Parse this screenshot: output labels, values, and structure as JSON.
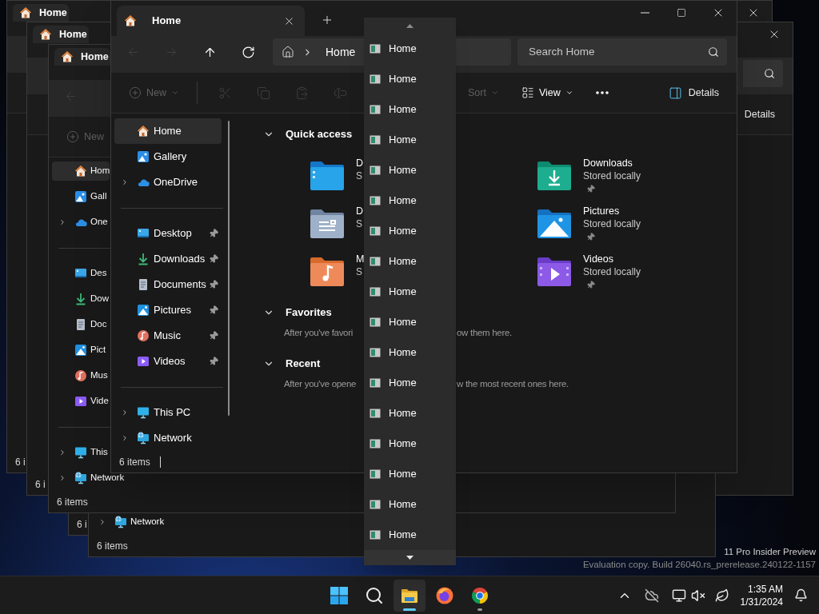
{
  "desktop": {
    "watermark": [
      "11 Pro Insider Preview",
      "Evaluation copy. Build 26040.rs_prerelease.240122-1157"
    ]
  },
  "windows": [
    {
      "tab": {
        "title": "Home",
        "selected": true
      },
      "window_buttons": [
        {
          "kind": "close"
        }
      ],
      "status": "6 i"
    },
    {
      "tab": {
        "title": "Home",
        "selected": true
      },
      "window_buttons": [
        {
          "kind": "close"
        }
      ],
      "search_icon": true,
      "details": {
        "label": "Details"
      },
      "status": "6 i"
    },
    {
      "status": "6 i"
    },
    {
      "nav": {
        "groups": [
          [
            {
              "kind": "network",
              "label": "Network",
              "expandable": true,
              "selected": false
            }
          ]
        ]
      },
      "status": "6 items"
    },
    {
      "tab": {
        "title": "Home",
        "selected": true
      },
      "nav_buttons": [
        {
          "kind": "back",
          "disabled": true
        }
      ],
      "commands": [
        {
          "kind": "new",
          "label": "New",
          "disabled": true
        }
      ],
      "nav": {
        "groups": [
          [
            {
              "kind": "home",
              "label": "Hom",
              "selected": true
            },
            {
              "kind": "gallery",
              "label": "Gall",
              "selected": false
            },
            {
              "kind": "onedrive",
              "label": "One",
              "expandable": true,
              "selected": false
            }
          ],
          [
            {
              "kind": "desktop",
              "label": "Des",
              "selected": false
            },
            {
              "kind": "downloads",
              "label": "Dow",
              "selected": false
            },
            {
              "kind": "documents",
              "label": "Doc",
              "selected": false
            },
            {
              "kind": "pictures",
              "label": "Pict",
              "selected": false
            },
            {
              "kind": "music",
              "label": "Mus",
              "selected": false
            },
            {
              "kind": "videos",
              "label": "Vide",
              "selected": false
            }
          ],
          [
            {
              "kind": "thispc",
              "label": "This",
              "expandable": true,
              "selected": false
            },
            {
              "kind": "network",
              "label": "Network",
              "expandable": true,
              "selected": false
            }
          ]
        ]
      },
      "status": "6 items"
    },
    {
      "tab": {
        "title": "Home",
        "selected": true,
        "closable": true
      },
      "new_tab_button": true,
      "window_buttons": [
        {
          "kind": "minimize"
        },
        {
          "kind": "maximize"
        },
        {
          "kind": "close"
        }
      ],
      "nav_buttons": [
        {
          "kind": "back",
          "disabled": true
        },
        {
          "kind": "forward",
          "disabled": true
        },
        {
          "kind": "up",
          "disabled": false
        },
        {
          "kind": "refresh",
          "disabled": false
        }
      ],
      "address": {
        "crumbs": [
          "Home"
        ]
      },
      "search": {
        "placeholder": "Search Home"
      },
      "commands": [
        {
          "kind": "new",
          "label": "New",
          "disabled": true
        },
        {
          "kind": "cut",
          "disabled": true
        },
        {
          "kind": "copy",
          "disabled": true
        },
        {
          "kind": "paste",
          "disabled": true
        },
        {
          "kind": "rename",
          "disabled": true
        },
        {
          "kind": "sort",
          "label": "Sort",
          "disabled": true
        },
        {
          "kind": "view",
          "label": "View",
          "disabled": false
        },
        {
          "kind": "more",
          "disabled": false
        }
      ],
      "details": {
        "label": "Details"
      },
      "nav": {
        "scrollbar": true,
        "groups": [
          [
            {
              "kind": "home",
              "label": "Home",
              "selected": true
            },
            {
              "kind": "gallery",
              "label": "Gallery",
              "selected": false
            },
            {
              "kind": "onedrive",
              "label": "OneDrive",
              "expandable": true,
              "selected": false
            }
          ],
          [
            {
              "kind": "desktop",
              "label": "Desktop",
              "pinned": true,
              "selected": false
            },
            {
              "kind": "downloads",
              "label": "Downloads",
              "pinned": true,
              "selected": false
            },
            {
              "kind": "documents",
              "label": "Documents",
              "pinned": true,
              "selected": false
            },
            {
              "kind": "pictures",
              "label": "Pictures",
              "pinned": true,
              "selected": false
            },
            {
              "kind": "music",
              "label": "Music",
              "pinned": true,
              "selected": false
            },
            {
              "kind": "videos",
              "label": "Videos",
              "pinned": true,
              "selected": false
            }
          ],
          [
            {
              "kind": "thispc",
              "label": "This PC",
              "expandable": true,
              "selected": false
            },
            {
              "kind": "network",
              "label": "Network",
              "expandable": true,
              "selected": false
            }
          ]
        ]
      },
      "sections": [
        {
          "title": "Quick access",
          "expanded": true,
          "items": [
            {
              "kind": "desktop",
              "name": "D",
              "detail": "S"
            },
            {
              "kind": "downloads",
              "name": "Downloads",
              "detail": "Stored locally",
              "pinned": true
            },
            {
              "kind": "documents",
              "name": "D",
              "detail": "S"
            },
            {
              "kind": "pictures",
              "name": "Pictures",
              "detail": "Stored locally",
              "pinned": true
            },
            {
              "kind": "music",
              "name": "M",
              "detail": "S"
            },
            {
              "kind": "videos",
              "name": "Videos",
              "detail": "Stored locally",
              "pinned": true
            }
          ]
        },
        {
          "title": "Favorites",
          "expanded": true,
          "message": [
            "After you've favori",
            "ow them here."
          ]
        },
        {
          "title": "Recent",
          "expanded": true,
          "message": [
            "After you've opene",
            "w the most recent ones here."
          ]
        }
      ],
      "status": "6 items"
    }
  ],
  "dropdown": {
    "items": [
      "Home",
      "Home",
      "Home",
      "Home",
      "Home",
      "Home",
      "Home",
      "Home",
      "Home",
      "Home",
      "Home",
      "Home",
      "Home",
      "Home",
      "Home",
      "Home",
      "Home"
    ]
  },
  "taskbar": {
    "apps": [
      {
        "kind": "start",
        "active": false,
        "running": false
      },
      {
        "kind": "search",
        "active": false,
        "running": false
      },
      {
        "kind": "explorer",
        "active": true,
        "running": false
      },
      {
        "kind": "firefox",
        "active": false,
        "running": false
      },
      {
        "kind": "chrome",
        "active": false,
        "running": true
      }
    ],
    "clock": {
      "time": "1:35 AM",
      "date": "1/31/2024"
    }
  }
}
